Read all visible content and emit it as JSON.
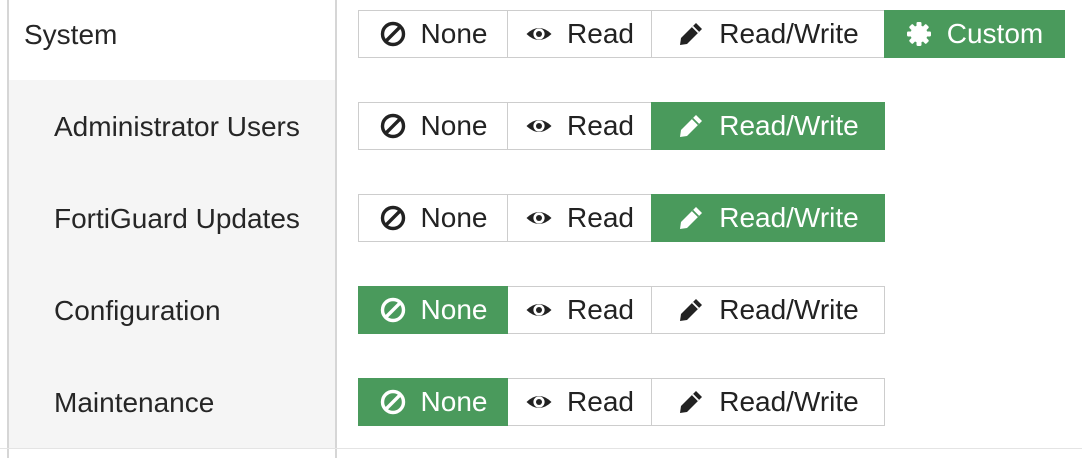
{
  "options": {
    "none": "None",
    "read": "Read",
    "read_write": "Read/Write",
    "custom": "Custom"
  },
  "rows": [
    {
      "label": "System",
      "selected": "custom"
    },
    {
      "label": "Administrator Users",
      "selected": "read_write"
    },
    {
      "label": "FortiGuard Updates",
      "selected": "read_write"
    },
    {
      "label": "Configuration",
      "selected": "none"
    },
    {
      "label": "Maintenance",
      "selected": "none"
    }
  ],
  "colors": {
    "active": "#4a9a5c",
    "border": "#cdcdcd",
    "sub_background": "#f5f5f5"
  },
  "icons": {
    "none": "ban-icon",
    "read": "eye-icon",
    "read_write": "pencil-icon",
    "custom": "gear-icon"
  }
}
